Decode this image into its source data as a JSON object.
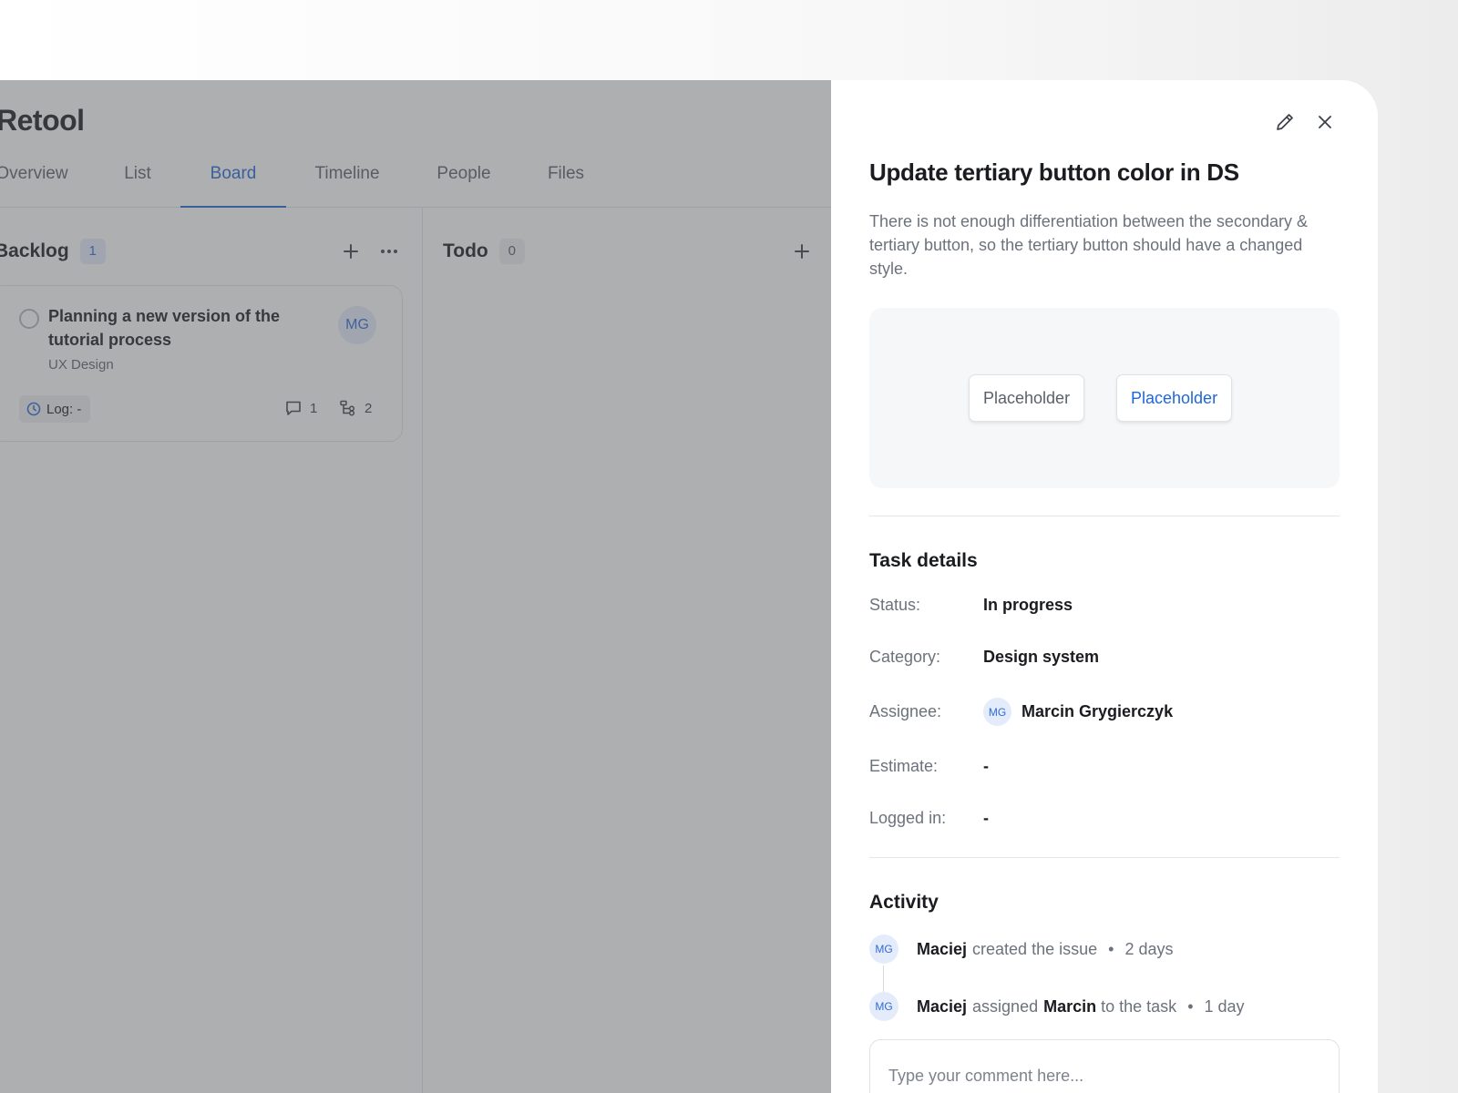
{
  "app": {
    "title": "Retool"
  },
  "tabs": [
    {
      "label": "Overview"
    },
    {
      "label": "List"
    },
    {
      "label": "Board"
    },
    {
      "label": "Timeline"
    },
    {
      "label": "People"
    },
    {
      "label": "Files"
    }
  ],
  "active_tab": "Board",
  "columns": [
    {
      "name": "Backlog",
      "count": "1",
      "cards": [
        {
          "title": "Planning a new version of the tutorial process",
          "category": "UX Design",
          "assignee_initials": "MG",
          "log": "Log: -",
          "comments": "1",
          "subtasks": "2"
        }
      ]
    },
    {
      "name": "Todo",
      "count": "0",
      "cards": []
    }
  ],
  "panel": {
    "title": "Update tertiary button color in DS",
    "description": "There is not enough differentiation between the secondary & tertiary button, so the tertiary button should have a changed style.",
    "preview": {
      "secondary_label": "Placeholder",
      "tertiary_label": "Placeholder",
      "tertiary_color": "#1f66d9"
    },
    "details": {
      "heading": "Task details",
      "status_label": "Status:",
      "status_value": "In progress",
      "category_label": "Category:",
      "category_value": "Design system",
      "assignee_label": "Assignee:",
      "assignee_initials": "MG",
      "assignee_name": "Marcin Grygierczyk",
      "estimate_label": "Estimate:",
      "estimate_value": "-",
      "logged_label": "Logged in:",
      "logged_value": "-"
    },
    "activity": {
      "heading": "Activity",
      "items": [
        {
          "initials": "MG",
          "actor": "Maciej",
          "action": "created the issue",
          "target": "",
          "suffix": "",
          "time": "2 days"
        },
        {
          "initials": "MG",
          "actor": "Maciej",
          "action": "assigned",
          "target": "Marcin",
          "suffix": "to the task",
          "time": "1 day"
        }
      ]
    },
    "comment_placeholder": "Type your comment here..."
  },
  "colors": {
    "accent": "#1f66d9",
    "overlay": "rgba(86,88,92,0.48)",
    "avatar_bg": "#e4ecfb"
  }
}
